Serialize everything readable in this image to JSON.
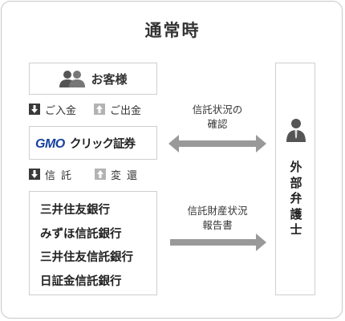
{
  "title": "通常時",
  "customer": {
    "label": "お客様",
    "icon": "people-icon"
  },
  "flow_top": [
    {
      "label": "ご入金",
      "icon": "arrow-down-icon"
    },
    {
      "label": "ご出金",
      "icon": "arrow-up-icon"
    }
  ],
  "company": {
    "logo_text": "GMOクリック証券",
    "logo_color": "#1640a0"
  },
  "flow_bottom": [
    {
      "label": "信託",
      "icon": "arrow-down-icon"
    },
    {
      "label": "変還",
      "icon": "arrow-up-icon"
    }
  ],
  "banks": [
    "三井住友銀行",
    "みずほ信託銀行",
    "三井住友信託銀行",
    "日証金信託銀行"
  ],
  "arrow_captions": {
    "confirm": [
      "信託状況の",
      "確認"
    ],
    "report": [
      "信託財産状況",
      "報告書"
    ]
  },
  "external": {
    "label": "外部弁護士",
    "icon": "person-icon"
  },
  "colors": {
    "border": "#cfcfcf",
    "arrow": "#999999",
    "dark_icon": "#3a3a3a",
    "light_icon": "#b3b3b3"
  }
}
